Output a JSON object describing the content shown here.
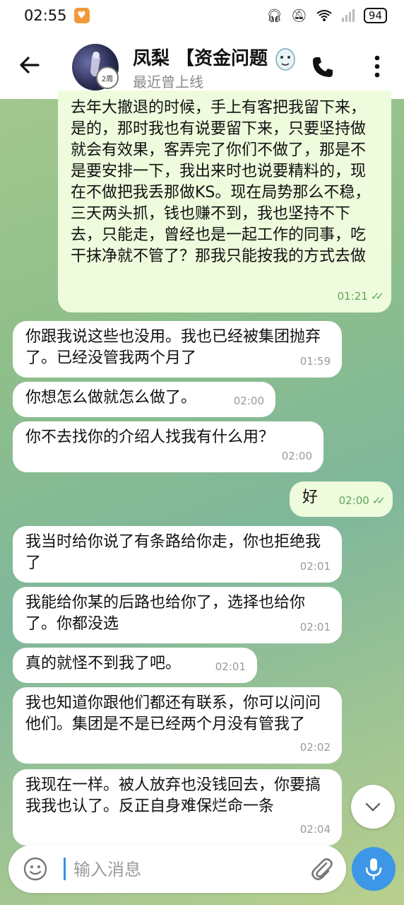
{
  "status_bar": {
    "time": "02:55",
    "battery": "94"
  },
  "header": {
    "title": "凤梨 【资金问题",
    "subtitle": "最近曾上线",
    "avatar_badge": "2周"
  },
  "messages": [
    {
      "dir": "out",
      "text": "去年大撤退的时候，手上有客把我留下来，是的，那时我也有说要留下来，只要坚持做就会有效果，客弄完了你们不做了，那是不是要安排一下，我出来时也说要精料的，现在不做把我丢那做KS。现在局势那么不稳，三天两头抓，钱也赚不到，我也坚持不下去，只能走，曾经也是一起工作的同事，吃干抹净就不管了？那我只能按我的方式去做",
      "time": "01:21",
      "read": "✓✓"
    },
    {
      "dir": "in",
      "text": "你跟我说这些也没用。我也已经被集团抛弃了。已经没管我两个月了",
      "time": "01:59"
    },
    {
      "dir": "in",
      "text": "你想怎么做就怎么做了。",
      "time": "02:00"
    },
    {
      "dir": "in",
      "text": "你不去找你的介绍人找我有什么用？",
      "time": "02:00"
    },
    {
      "dir": "out",
      "text": "好",
      "time": "02:00",
      "read": "✓✓"
    },
    {
      "dir": "in",
      "text": "我当时给你说了有条路给你走，你也拒绝我了",
      "time": "02:01"
    },
    {
      "dir": "in",
      "text": "我能给你某的后路也给你了，选择也给你了。你都没选",
      "time": "02:01"
    },
    {
      "dir": "in",
      "text": "真的就怪不到我了吧。",
      "time": "02:01"
    },
    {
      "dir": "in",
      "text": "我也知道你跟他们都还有联系，你可以问问他们。集团是不是已经两个月没有管我了",
      "time": "02:02"
    },
    {
      "dir": "in",
      "text": "我现在一样。被人放弃也没钱回去，你要搞我我也认了。反正自身难保烂命一条",
      "time": "02:04"
    }
  ],
  "input": {
    "placeholder": "输入消息"
  },
  "colors": {
    "outgoing_bubble": "#eefbdc",
    "incoming_bubble": "#ffffff",
    "accent": "#3d97e6"
  }
}
